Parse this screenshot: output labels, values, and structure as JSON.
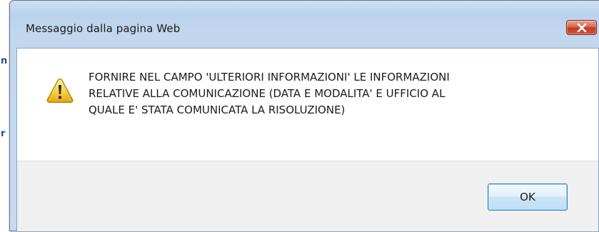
{
  "background": {
    "fragment_1": "n",
    "fragment_2": "r"
  },
  "dialog": {
    "title": "Messaggio dalla pagina Web",
    "message": "FORNIRE NEL CAMPO 'ULTERIORI INFORMAZIONI' LE INFORMAZIONI\nRELATIVE ALLA COMUNICAZIONE (DATA E MODALITA' E UFFICIO AL\nQUALE E' STATA COMUNICATA LA RISOLUZIONE)",
    "icon": "warning-icon",
    "ok_label": "OK",
    "close_icon": "close-icon"
  },
  "colors": {
    "titlebar": "#c2d6ee",
    "close_button": "#c2391f",
    "ok_border": "#3c7fb1",
    "warning_fill": "#f6d23f"
  }
}
